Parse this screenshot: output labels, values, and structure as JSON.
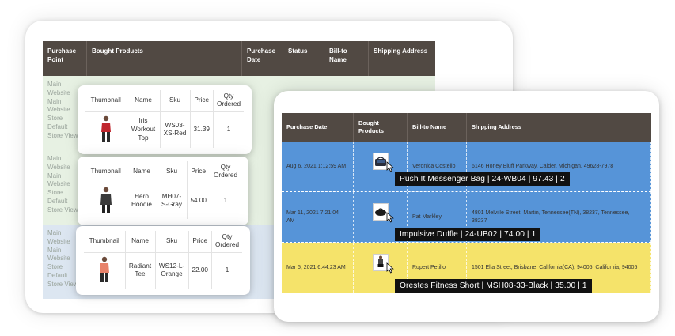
{
  "back_table": {
    "headers": [
      "Purchase Point",
      "Bought Products",
      "Purchase Date",
      "Status",
      "Bill-to Name",
      "Shipping Address"
    ],
    "rows": [
      {
        "store_text": "Main\nWebsite\nMain\nWebsite\nStore\nDefault\nStore View"
      },
      {
        "store_text": "Main\nWebsite\nMain\nWebsite\nStore\nDefault\nStore View"
      },
      {
        "store_text": "Main\nWebsite\nMain\nWebsite\nStore\nDefault\nStore View"
      }
    ]
  },
  "popups": [
    {
      "headers": [
        "Thumbnail",
        "Name",
        "Sku",
        "Price",
        "Qty Ordered"
      ],
      "name": "Iris Workout Top",
      "sku": "WS03-XS-Red",
      "price": "31.39",
      "qty": "1"
    },
    {
      "headers": [
        "Thumbnail",
        "Name",
        "Sku",
        "Price",
        "Qty Ordered"
      ],
      "name": "Hero Hoodie",
      "sku": "MH07-S-Gray",
      "price": "54.00",
      "qty": "1"
    },
    {
      "headers": [
        "Thumbnail",
        "Name",
        "Sku",
        "Price",
        "Qty Ordered"
      ],
      "name": "Radiant Tee",
      "sku": "WS12-L-Orange",
      "price": "22.00",
      "qty": "1"
    }
  ],
  "front_table": {
    "headers": [
      "Purchase Date",
      "Bought Products",
      "Bill-to Name",
      "Shipping Address"
    ],
    "rows": [
      {
        "date": "Aug 6, 2021 1:12:59 AM",
        "bill_to": "Veronica Costello",
        "address": "6146 Honey Bluff Parkway, Calder, Michigan, 49628-7978",
        "tooltip": "Push It Messenger Bag | 24-WB04 | 97.43 | 2",
        "color": "#5694d8"
      },
      {
        "date": "Mar 11, 2021 7:21:04 AM",
        "bill_to": "Pat Markley",
        "address": "4801 Melville Street, Martin, Tennessee(TN), 38237, Tennessee, 38237",
        "tooltip": "Impulsive Duffle | 24-UB02 | 74.00 | 1",
        "color": "#5694d8"
      },
      {
        "date": "Mar 5, 2021 6:44:23 AM",
        "bill_to": "Rupert Petillo",
        "address": "1501 Ella Street, Brisbane, California(CA), 94005, California, 94005",
        "tooltip": "Orestes Fitness Short | MSH08-33-Black | 35.00 | 1",
        "color": "#f5e36a"
      }
    ]
  },
  "colors": {
    "header_bg": "#514943",
    "row_blue": "#5694d8",
    "row_yellow": "#f5e36a",
    "back_green": "#e7f1e3",
    "back_blue": "#dce6f1"
  }
}
